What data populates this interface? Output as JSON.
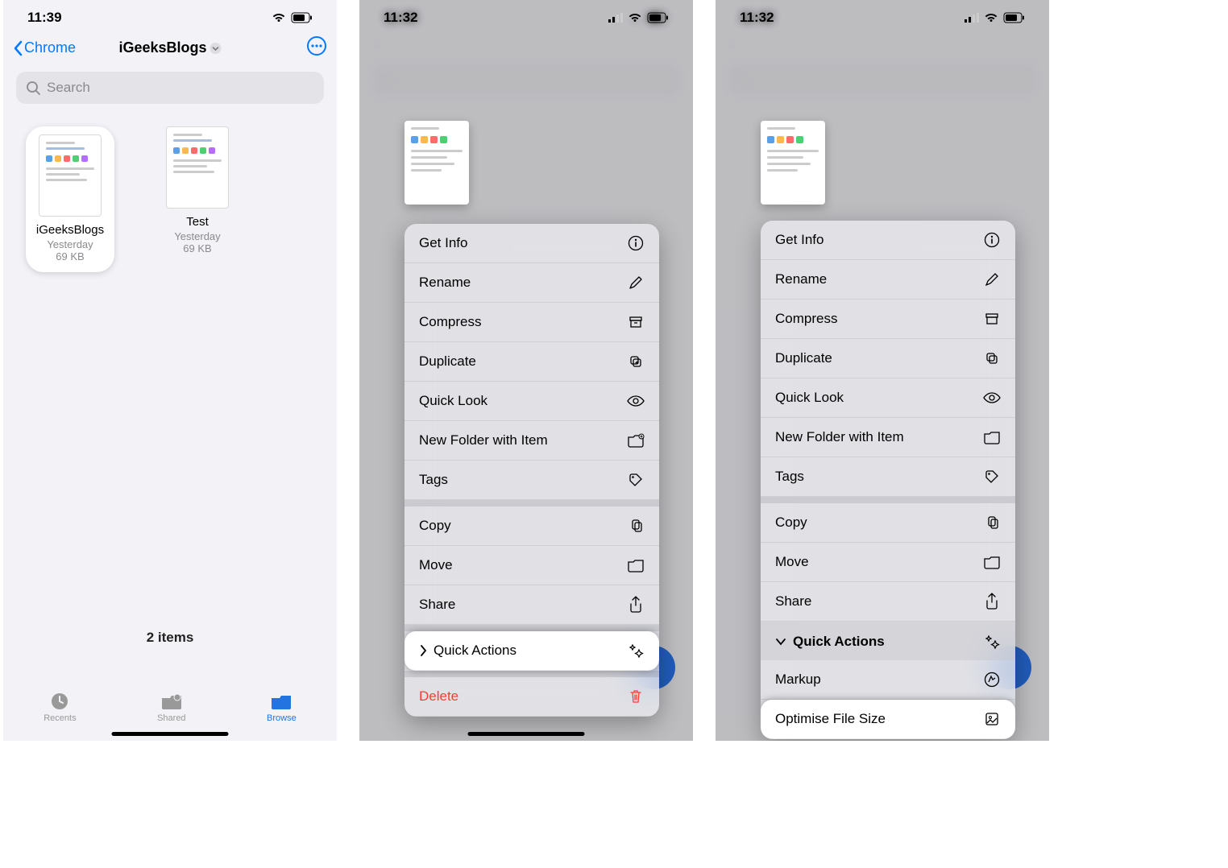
{
  "screen1": {
    "time": "11:39",
    "back_label": "Chrome",
    "title": "iGeeksBlogs",
    "search_placeholder": "Search",
    "files": [
      {
        "name": "iGeeksBlogs",
        "date": "Yesterday",
        "size": "69 KB"
      },
      {
        "name": "Test",
        "date": "Yesterday",
        "size": "69 KB"
      }
    ],
    "item_count": "2 items",
    "tabs": {
      "recents": "Recents",
      "shared": "Shared",
      "browse": "Browse"
    }
  },
  "screen2": {
    "time": "11:32",
    "menu": {
      "get_info": "Get Info",
      "rename": "Rename",
      "compress": "Compress",
      "duplicate": "Duplicate",
      "quick_look": "Quick Look",
      "new_folder": "New Folder with Item",
      "tags": "Tags",
      "copy": "Copy",
      "move": "Move",
      "share": "Share",
      "quick_actions": "Quick Actions",
      "delete": "Delete"
    }
  },
  "screen3": {
    "time": "11:32",
    "menu": {
      "get_info": "Get Info",
      "rename": "Rename",
      "compress": "Compress",
      "duplicate": "Duplicate",
      "quick_look": "Quick Look",
      "new_folder": "New Folder with Item",
      "tags": "Tags",
      "copy": "Copy",
      "move": "Move",
      "share": "Share",
      "quick_actions": "Quick Actions",
      "markup": "Markup",
      "optimise": "Optimise File Size"
    }
  }
}
